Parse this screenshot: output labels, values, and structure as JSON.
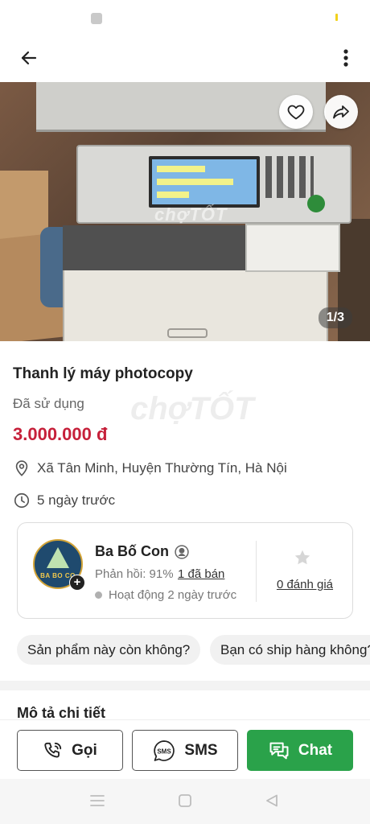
{
  "status_bar": {},
  "header": {
    "back_icon": "arrow-left-icon",
    "more_icon": "more-vertical-icon"
  },
  "gallery": {
    "counter": "1/3",
    "watermark": "chợTỐT",
    "favorite_icon": "heart-icon",
    "share_icon": "share-icon"
  },
  "listing": {
    "title": "Thanh lý máy photocopy",
    "condition": "Đã sử dụng",
    "price": "3.000.000 đ",
    "location": "Xã Tân Minh, Huyện Thường Tín, Hà Nội",
    "posted": "5 ngày trước",
    "watermark": "chợTỐT"
  },
  "seller": {
    "name": "Ba Bố Con",
    "avatar_text": "BA BO CO",
    "response_label": "Phản hồi: 91%",
    "sold_label": "1 đã bán",
    "active_label": "Hoạt động 2 ngày trước",
    "rating_label": "0 đánh giá",
    "follow_symbol": "+"
  },
  "quick_replies": [
    "Sản phẩm này còn không?",
    "Bạn có ship hàng không?"
  ],
  "description": {
    "title": "Mô tả chi tiết"
  },
  "actions": {
    "call_label": "Gọi",
    "sms_label": "SMS",
    "sms_icon_text": "SMS",
    "chat_label": "Chat"
  },
  "colors": {
    "price": "#c6203a",
    "chat_button": "#2aa24a"
  }
}
